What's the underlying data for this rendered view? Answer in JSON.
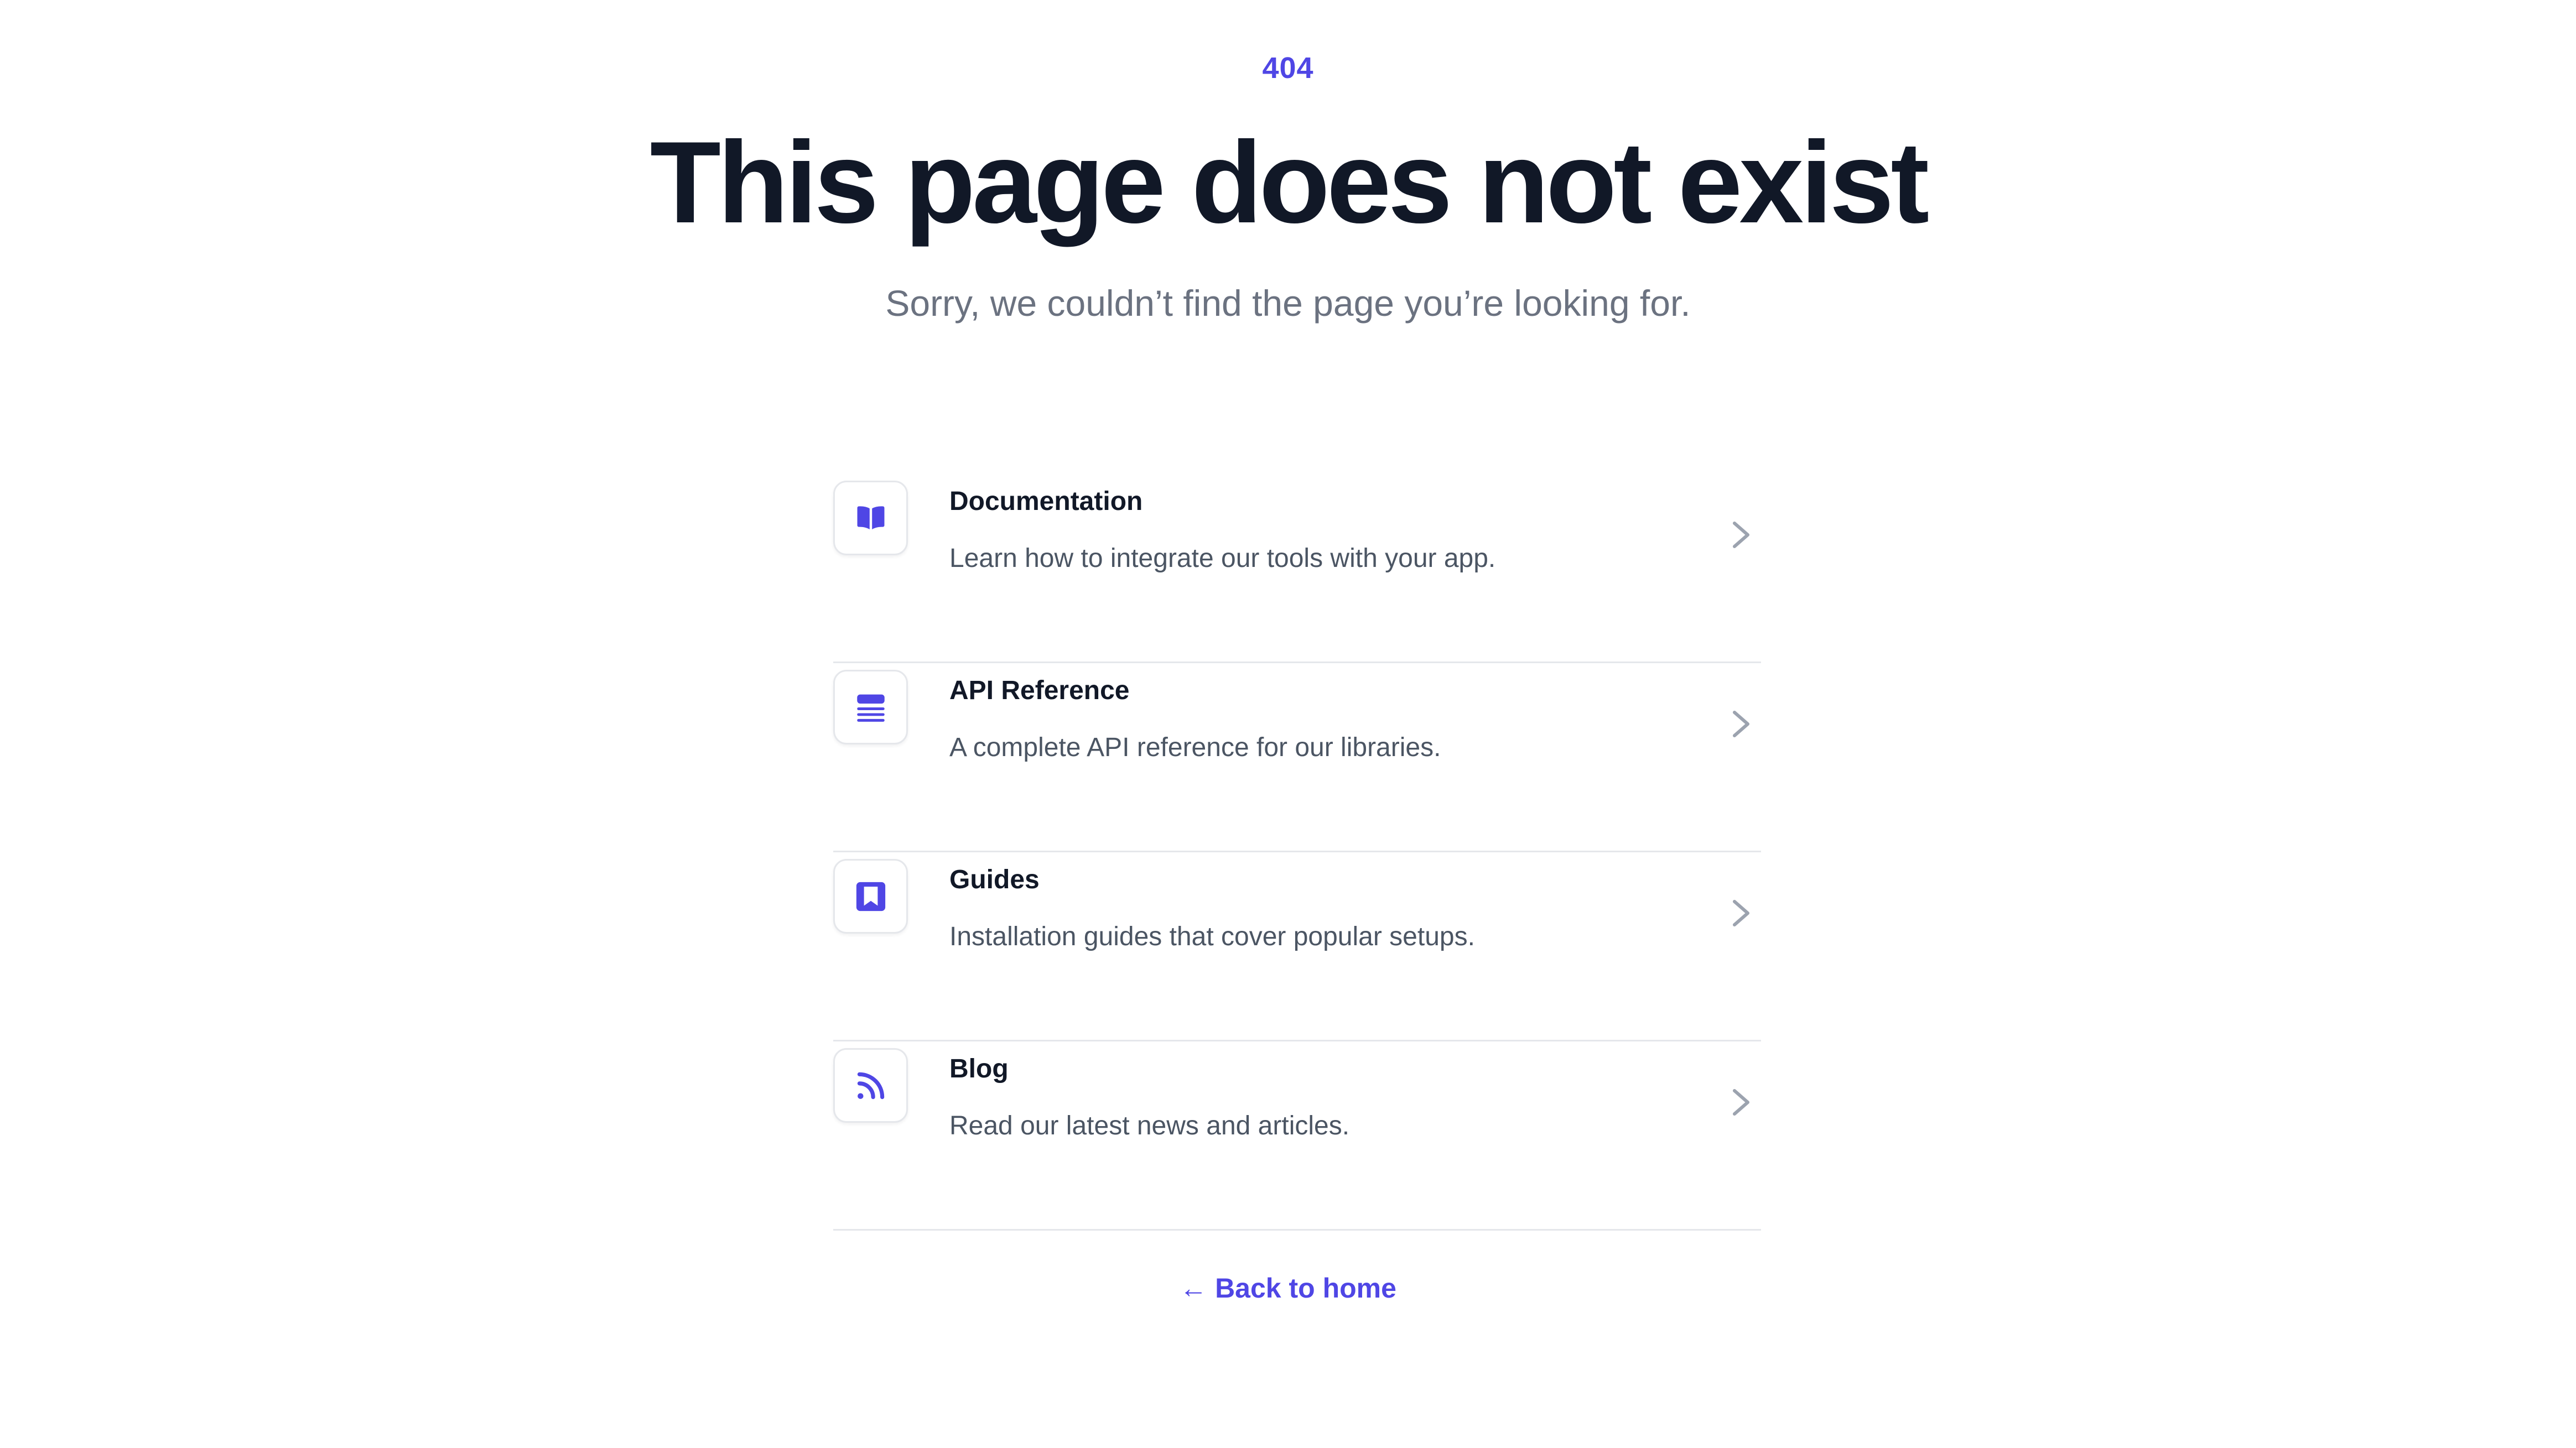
{
  "error": {
    "code": "404",
    "title": "This page does not exist",
    "subtitle": "Sorry, we couldn’t find the page you’re looking for."
  },
  "links": [
    {
      "icon": "book-open-icon",
      "title": "Documentation",
      "description": "Learn how to integrate our tools with your app."
    },
    {
      "icon": "queue-list-icon",
      "title": "API Reference",
      "description": "A complete API reference for our libraries."
    },
    {
      "icon": "bookmark-square-icon",
      "title": "Guides",
      "description": "Installation guides that cover popular setups."
    },
    {
      "icon": "rss-icon",
      "title": "Blog",
      "description": "Read our latest news and articles."
    }
  ],
  "back": {
    "arrow": "←",
    "label": "Back to home"
  },
  "colors": {
    "accent": "#4f46e5",
    "heading": "#111827",
    "muted": "#6b7280",
    "border": "#e5e7eb"
  }
}
